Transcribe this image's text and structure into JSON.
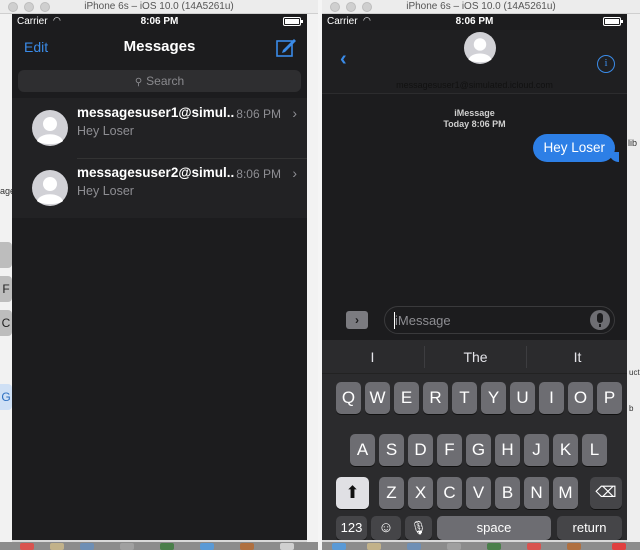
{
  "left_window": {
    "title": "iPhone 6s – iOS 10.0 (14A5261u)",
    "status": {
      "carrier": "Carrier",
      "time": "8:06 PM"
    },
    "nav": {
      "edit": "Edit",
      "title": "Messages"
    },
    "search_placeholder": "Search",
    "conversations": [
      {
        "name": "messagesuser1@simul...",
        "time": "8:06 PM",
        "preview": "Hey Loser"
      },
      {
        "name": "messagesuser2@simul...",
        "time": "8:06 PM",
        "preview": "Hey Loser"
      }
    ],
    "side_strip": [
      "F",
      "C",
      "G",
      "age"
    ]
  },
  "right_window": {
    "title": "iPhone 6s – iOS 10.0 (14A5261u)",
    "status": {
      "carrier": "Carrier",
      "time": "8:06 PM"
    },
    "contact_name": "messagesuser1@simulated.icloud.com",
    "thread_service": "iMessage",
    "thread_time": "Today 8:06 PM",
    "message": "Hey Loser",
    "input_placeholder": "iMessage",
    "suggestions": [
      "I",
      "The",
      "It"
    ],
    "keys": {
      "row1": [
        "Q",
        "W",
        "E",
        "R",
        "T",
        "Y",
        "U",
        "I",
        "O",
        "P"
      ],
      "row2": [
        "A",
        "S",
        "D",
        "F",
        "G",
        "H",
        "J",
        "K",
        "L"
      ],
      "row3": [
        "Z",
        "X",
        "C",
        "V",
        "B",
        "N",
        "M"
      ],
      "numbers": "123",
      "space": "space",
      "return": "return"
    },
    "side_strip": [
      "lib",
      "ucts",
      "b"
    ]
  },
  "colors": {
    "accent": "#3a8be8",
    "bubble": "#2d7fe6",
    "background": "#1c1c1e"
  },
  "icons": [
    "compose-icon",
    "search-icon",
    "avatar-icon",
    "chevron-right-icon",
    "back-chevron-icon",
    "info-icon",
    "apps-icon",
    "mic-icon",
    "shift-icon",
    "backspace-icon",
    "emoji-icon",
    "dictation-icon",
    "wifi-icon",
    "battery-icon"
  ]
}
